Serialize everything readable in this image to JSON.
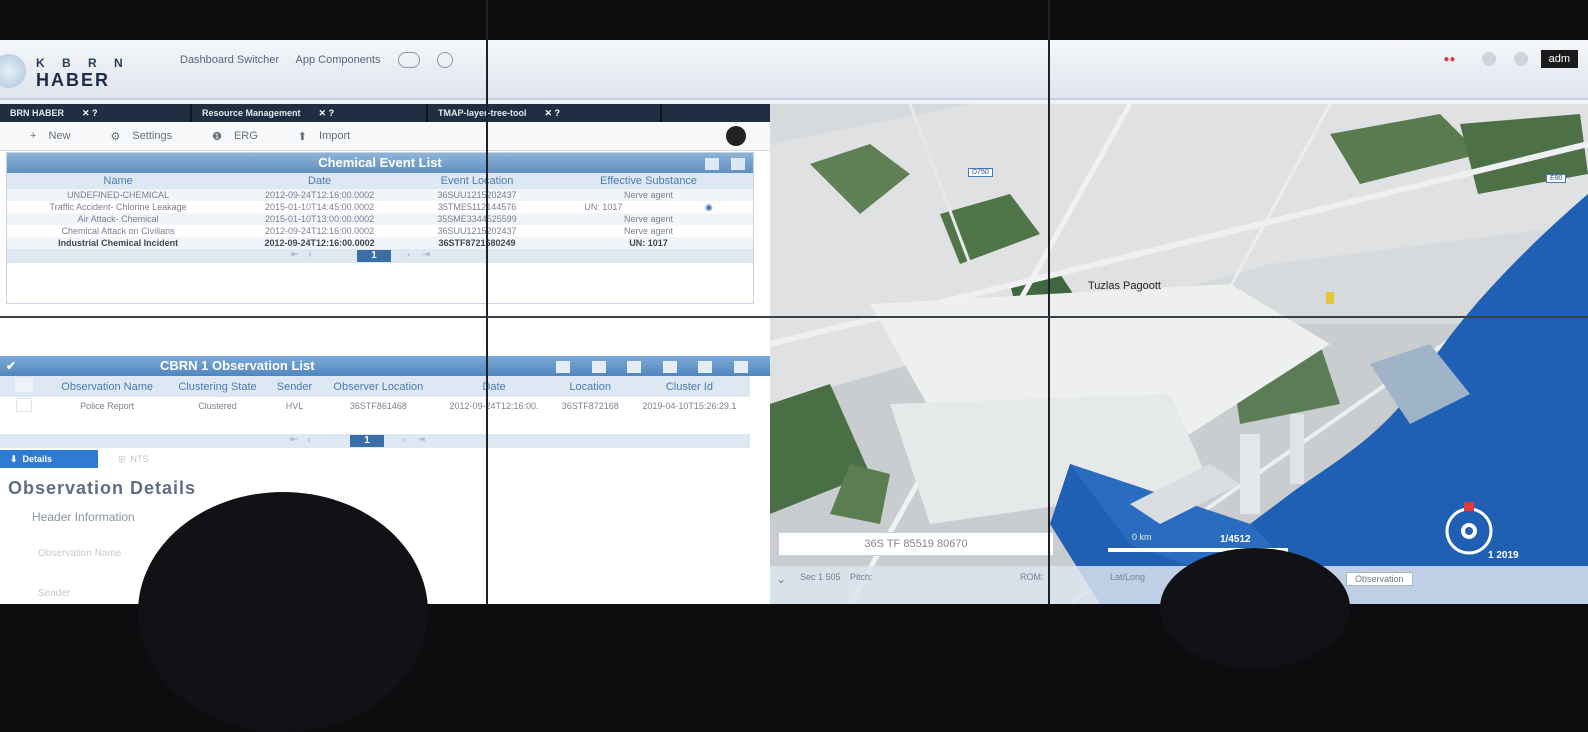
{
  "logo": {
    "line1": "K B R N",
    "line2": "HABER"
  },
  "topnav": {
    "dashboard_switcher": "Dashboard Switcher",
    "app_components": "App Components"
  },
  "topright": {
    "user": "adm"
  },
  "tabs": [
    {
      "label": "BRN HABER"
    },
    {
      "label": "Resource Management"
    },
    {
      "label": "TMAP-layer-tree-tool"
    }
  ],
  "toolbar": {
    "new": "New",
    "settings": "Settings",
    "erg": "ERG",
    "import": "Import"
  },
  "chemical_list": {
    "title": "Chemical Event List",
    "columns": [
      "Name",
      "Date",
      "Event Location",
      "Effective Substance"
    ],
    "rows": [
      {
        "name": "UNDEFINED-CHEMICAL",
        "date": "2012-09-24T12:16:00.0002",
        "location": "36SUU1215202437",
        "substance": "Nerve agent"
      },
      {
        "name": "Traffic Accident- Chlorine Leakage",
        "date": "2015-01-10T14:45:00.0002",
        "location": "35TME5112144576",
        "substance": "UN: 1017"
      },
      {
        "name": "Air Attack- Chemical",
        "date": "2015-01-10T13:00:00.0002",
        "location": "35SME3344525599",
        "substance": "Nerve agent"
      },
      {
        "name": "Chemical Attack on Civilians",
        "date": "2012-09-24T12:16:00.0002",
        "location": "36SUU1215202437",
        "substance": "Nerve agent"
      },
      {
        "name": "Industrial Chemical Incident",
        "date": "2012-09-24T12:16:00.0002",
        "location": "36STF8721680249",
        "substance": "UN: 1017"
      }
    ],
    "page": "1"
  },
  "observation_list": {
    "title": "CBRN 1 Observation List",
    "columns": [
      "Observation Name",
      "Clustering State",
      "Sender",
      "Observer Location",
      "Date",
      "Location",
      "Cluster Id"
    ],
    "rows": [
      {
        "name": "Police Report",
        "state": "Clustered",
        "sender": "HVL",
        "observer_location": "36STF861468",
        "date": "2012-09-24T12:16:00.",
        "location": "36STF872168",
        "cluster": "2019-04-10T15:26:29.1"
      }
    ],
    "page": "1"
  },
  "details": {
    "tab_active": "Details",
    "tab_other": "NTS",
    "title": "Observation Details",
    "section": "Header Information",
    "field1": "Observation Name",
    "field2": "Sender"
  },
  "map": {
    "place_label": "Tuzlas Pagoott",
    "road_badge_1": "D750",
    "road_badge_2": "E90",
    "coordinate": "36S TF 85519 80670",
    "scale": "1/4512",
    "scale_small": "0 km",
    "time": "1 2019",
    "status_1": "Sec 1 505",
    "status_2": "Pitch:",
    "status_3": "ROM:",
    "status_4": "Lat/Long",
    "status_btn": "Observation"
  },
  "colors": {
    "panel_header": "#5f8fc0",
    "tab_bar": "#1f2e40",
    "detail_tab": "#2f7bd3",
    "sea": "#1f5fb4"
  }
}
